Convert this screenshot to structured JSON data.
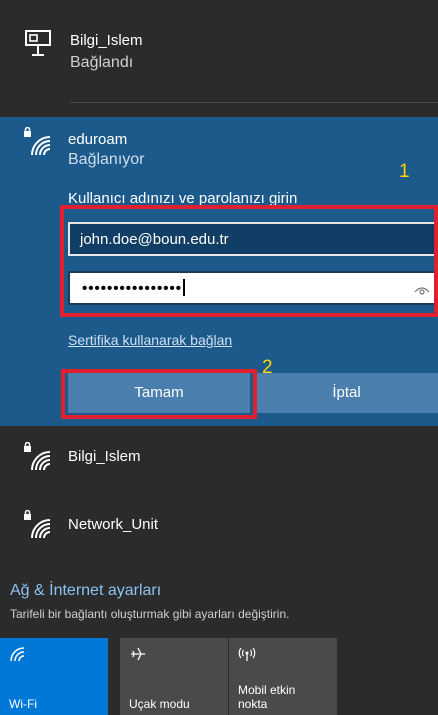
{
  "wired": {
    "name": "Bilgi_Islem",
    "status": "Bağlandı",
    "icon": "ethernet-icon"
  },
  "connecting": {
    "name": "eduroam",
    "status": "Bağlanıyor",
    "prompt": "Kullanıcı adınızı ve parolanızı girin",
    "username_value": "john.doe@boun.edu.tr",
    "password_mask": "••••••••••••••••",
    "cert_link": "Sertifika kullanarak bağlan",
    "ok_label": "Tamam",
    "cancel_label": "İptal",
    "icon": "secured-wifi-icon"
  },
  "annotations": {
    "a1": "1",
    "a2": "2",
    "color": "#ffd400",
    "box_color": "#e0202e"
  },
  "networks": [
    {
      "name": "Bilgi_Islem",
      "icon": "secured-wifi-icon"
    },
    {
      "name": "Network_Unit",
      "icon": "secured-wifi-icon"
    }
  ],
  "settings": {
    "title": "Ağ & İnternet ayarları",
    "subtitle": "Tarifeli bir bağlantı oluşturmak gibi ayarları değiştirin."
  },
  "tiles": [
    {
      "label": "Wi-Fi",
      "icon": "wifi-icon",
      "active": true
    },
    {
      "label": "Uçak modu",
      "icon": "airplane-icon",
      "active": false
    },
    {
      "label": "Mobil etkin\nnokta",
      "icon": "hotspot-icon",
      "active": false
    }
  ],
  "colors": {
    "accent": "#0078d7",
    "connecting_bg": "#1d5a8c",
    "panel_bg": "#2b2b2b",
    "button": "#4a7fad"
  }
}
